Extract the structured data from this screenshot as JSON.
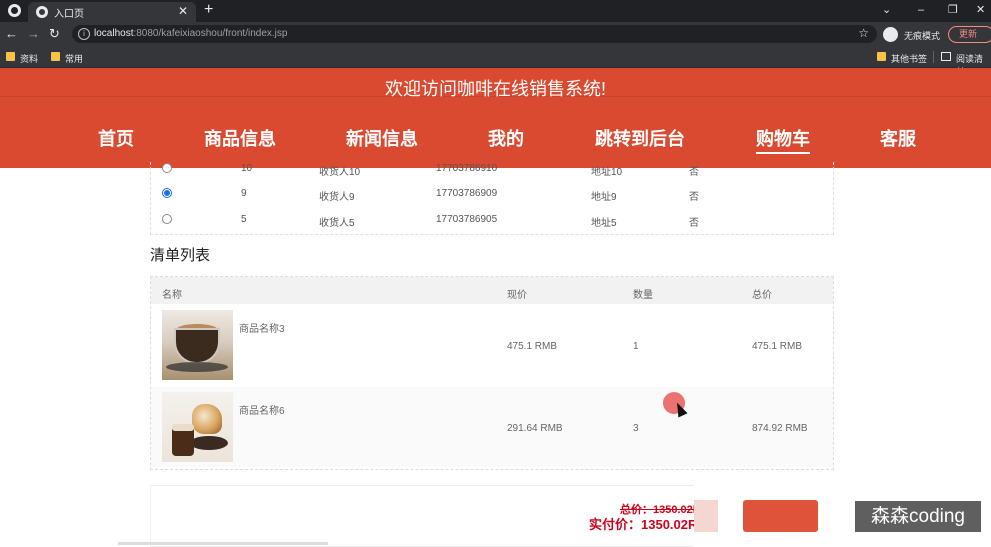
{
  "browser": {
    "tab_title": "入口页",
    "new_tab": "+",
    "window_controls": [
      "⌄",
      "–",
      "❐",
      "✕"
    ],
    "url_host": "localhost",
    "url_rest": ":8080/kafeixiaoshou/front/index.jsp",
    "incognito_label": "无痕模式",
    "update_label": "更新",
    "bookmarks": [
      "资料",
      "常用"
    ],
    "bookmarks_right": [
      "其他书签",
      "阅读清单"
    ]
  },
  "site": {
    "welcome": "欢迎访问咖啡在线销售系统!",
    "nav": [
      "首页",
      "商品信息",
      "新闻信息",
      "我的",
      "跳转到后台",
      "购物车",
      "客服"
    ],
    "active_nav": "购物车"
  },
  "addresses": [
    {
      "selected": false,
      "id": "10",
      "receiver": "收货人10",
      "phone": "17703786910",
      "address": "地址10",
      "default": "否"
    },
    {
      "selected": true,
      "id": "9",
      "receiver": "收货人9",
      "phone": "17703786909",
      "address": "地址9",
      "default": "否"
    },
    {
      "selected": false,
      "id": "5",
      "receiver": "收货人5",
      "phone": "17703786905",
      "address": "地址5",
      "default": "否"
    }
  ],
  "order_list": {
    "title": "清单列表",
    "headers": [
      "名称",
      "现价",
      "数量",
      "总价"
    ],
    "items": [
      {
        "name": "商品名称3",
        "price": "475.1 RMB",
        "qty": "1",
        "total": "475.1 RMB"
      },
      {
        "name": "商品名称6",
        "price": "291.64 RMB",
        "qty": "3",
        "total": "874.92 RMB"
      }
    ]
  },
  "totals": {
    "original": "总价：1350.02R",
    "actual": "实付价：1350.02R"
  },
  "watermark": "森森coding"
}
